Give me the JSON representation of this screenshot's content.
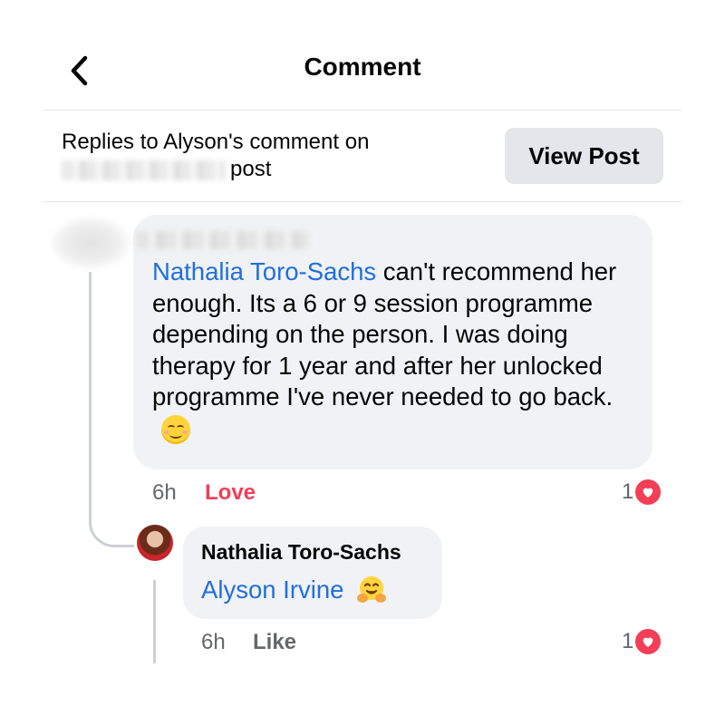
{
  "header": {
    "title": "Comment",
    "back_icon": "chevron-left-icon"
  },
  "context": {
    "replies_prefix": "Replies to Alyson's comment on",
    "post_suffix": "post",
    "view_post_label": "View Post"
  },
  "comment": {
    "mention": "Nathalia Toro-Sachs",
    "text": " can't recommend her enough. Its a 6 or 9 session programme depending on the person. I was doing therapy for 1 year and after her unlocked programme I've never needed to go back.",
    "emoji": "smiling-face-icon",
    "time": "6h",
    "reaction_label": "Love",
    "reaction_count": "1",
    "reaction_icon": "heart-icon"
  },
  "reply": {
    "author": "Nathalia Toro-Sachs",
    "mention": "Alyson Irvine",
    "emoji": "hugging-face-icon",
    "time": "6h",
    "reaction_label": "Like",
    "reaction_count": "1",
    "reaction_icon": "heart-icon"
  },
  "colors": {
    "accent": "#216fdb",
    "love": "#f33e58",
    "bubble": "#f0f2f5",
    "secondary_text": "#65676b"
  }
}
